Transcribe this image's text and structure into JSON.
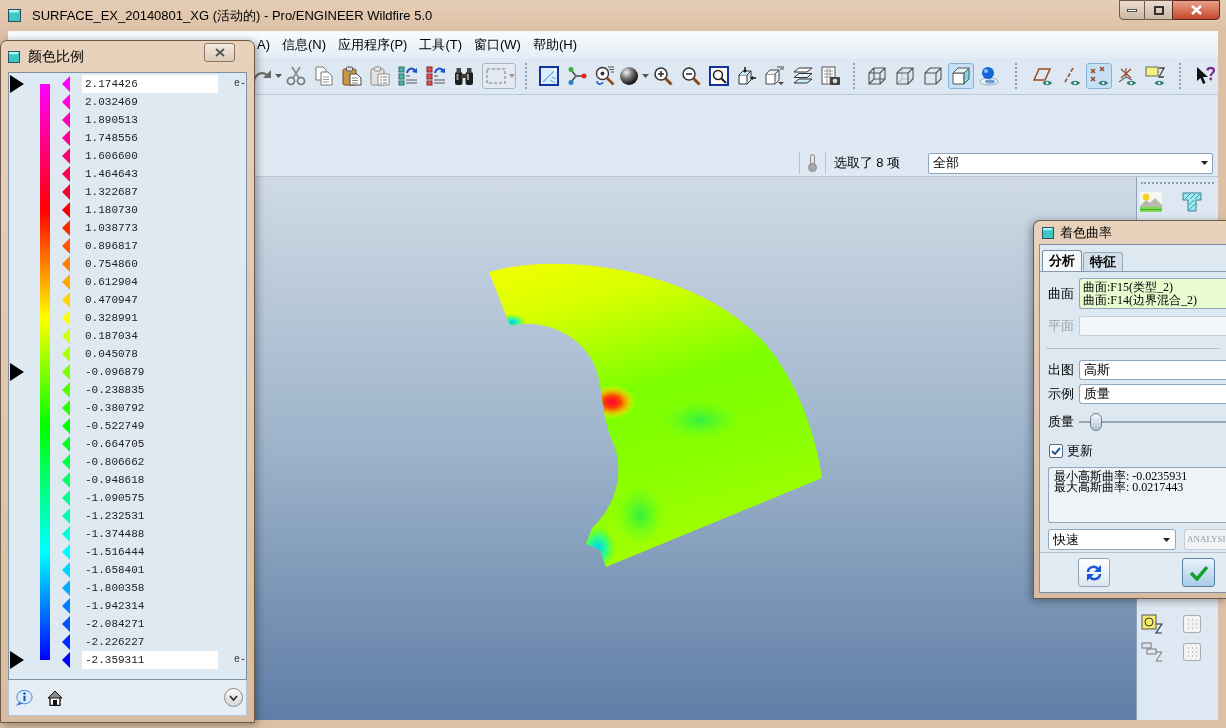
{
  "window": {
    "title": "SURFACE_EX_20140801_XG (活动的) - Pro/ENGINEER Wildfire 5.0"
  },
  "menu": [
    {
      "label": "A)"
    },
    {
      "label": "信息(N)"
    },
    {
      "label": "应用程序(P)"
    },
    {
      "label": "工具(T)"
    },
    {
      "label": "窗口(W)"
    },
    {
      "label": "帮助(H)"
    }
  ],
  "toolbar": {
    "display_style": [
      {
        "selected": false
      },
      {
        "selected": false
      },
      {
        "selected": false
      },
      {
        "selected": true
      },
      {
        "selected": false
      }
    ],
    "datum_display": [
      {
        "on": false
      },
      {
        "on": false
      },
      {
        "on": true
      },
      {
        "on": false
      },
      {
        "on": false
      }
    ]
  },
  "selection": {
    "status": "选取了 8 项",
    "filter": "全部"
  },
  "color_scale": {
    "title": "颜色比例",
    "levels": [
      {
        "value": "2.174426",
        "color": "#ff00ff",
        "kind": "field",
        "pointer": true,
        "suffix": "e-"
      },
      {
        "value": "2.032469",
        "color": "#ff00db",
        "kind": "text",
        "pointer": false
      },
      {
        "value": "1.890513",
        "color": "#ff00b6",
        "kind": "text",
        "pointer": false
      },
      {
        "value": "1.748556",
        "color": "#ff0092",
        "kind": "text",
        "pointer": false
      },
      {
        "value": "1.606600",
        "color": "#ff006d",
        "kind": "text",
        "pointer": false
      },
      {
        "value": "1.464643",
        "color": "#ff0049",
        "kind": "text",
        "pointer": false
      },
      {
        "value": "1.322687",
        "color": "#ff0024",
        "kind": "text",
        "pointer": false
      },
      {
        "value": "1.180730",
        "color": "#ff0000",
        "kind": "text",
        "pointer": false
      },
      {
        "value": "1.038773",
        "color": "#ff2a00",
        "kind": "text",
        "pointer": false
      },
      {
        "value": "0.896817",
        "color": "#ff5500",
        "kind": "text",
        "pointer": false
      },
      {
        "value": "0.754860",
        "color": "#ff8000",
        "kind": "text",
        "pointer": false
      },
      {
        "value": "0.612904",
        "color": "#ffaa00",
        "kind": "text",
        "pointer": false
      },
      {
        "value": "0.470947",
        "color": "#ffd400",
        "kind": "text",
        "pointer": false
      },
      {
        "value": "0.328991",
        "color": "#ffff00",
        "kind": "text",
        "pointer": false
      },
      {
        "value": "0.187034",
        "color": "#d4ff00",
        "kind": "text",
        "pointer": false
      },
      {
        "value": "0.045078",
        "color": "#aaff00",
        "kind": "text",
        "pointer": false
      },
      {
        "value": "-0.096879",
        "color": "#80ff00",
        "kind": "text",
        "pointer": true
      },
      {
        "value": "-0.238835",
        "color": "#55ff00",
        "kind": "text",
        "pointer": false
      },
      {
        "value": "-0.380792",
        "color": "#2aff00",
        "kind": "text",
        "pointer": false
      },
      {
        "value": "-0.522749",
        "color": "#00ff00",
        "kind": "text",
        "pointer": false
      },
      {
        "value": "-0.664705",
        "color": "#00ff24",
        "kind": "text",
        "pointer": false
      },
      {
        "value": "-0.806662",
        "color": "#00ff49",
        "kind": "text",
        "pointer": false
      },
      {
        "value": "-0.948618",
        "color": "#00ff6d",
        "kind": "text",
        "pointer": false
      },
      {
        "value": "-1.090575",
        "color": "#00ff92",
        "kind": "text",
        "pointer": false
      },
      {
        "value": "-1.232531",
        "color": "#00ffb6",
        "kind": "text",
        "pointer": false
      },
      {
        "value": "-1.374488",
        "color": "#00ffdb",
        "kind": "text",
        "pointer": false
      },
      {
        "value": "-1.516444",
        "color": "#00ffff",
        "kind": "text",
        "pointer": false
      },
      {
        "value": "-1.658401",
        "color": "#00d4ff",
        "kind": "text",
        "pointer": false
      },
      {
        "value": "-1.800358",
        "color": "#00aaff",
        "kind": "text",
        "pointer": false
      },
      {
        "value": "-1.942314",
        "color": "#0080ff",
        "kind": "text",
        "pointer": false
      },
      {
        "value": "-2.084271",
        "color": "#0055ff",
        "kind": "text",
        "pointer": false
      },
      {
        "value": "-2.226227",
        "color": "#002aff",
        "kind": "text",
        "pointer": false
      },
      {
        "value": "-2.359311",
        "color": "#0000ff",
        "kind": "field",
        "pointer": true,
        "suffix": "e-"
      }
    ]
  },
  "curvature_dialog": {
    "title": "着色曲率",
    "tabs": [
      {
        "label": "分析",
        "selected": true
      },
      {
        "label": "特征",
        "selected": false
      }
    ],
    "surface": {
      "label": "曲面",
      "items": [
        "曲面:F15(类型_2)",
        "曲面:F14(边界混合_2)"
      ]
    },
    "plane": {
      "label": "平面",
      "disabled": true
    },
    "output": {
      "label": "出图",
      "value": "高斯"
    },
    "sample": {
      "label": "示例",
      "value": "质量"
    },
    "quality": {
      "label": "质量",
      "level": 0.08
    },
    "update": {
      "label": "更新",
      "checked": true
    },
    "results": [
      "最小高斯曲率: -0.0235931",
      "最大高斯曲率: 0.0217443"
    ],
    "mode": {
      "value": "快速"
    },
    "name_field": {
      "value": "ANALYSI",
      "disabled": true
    }
  }
}
